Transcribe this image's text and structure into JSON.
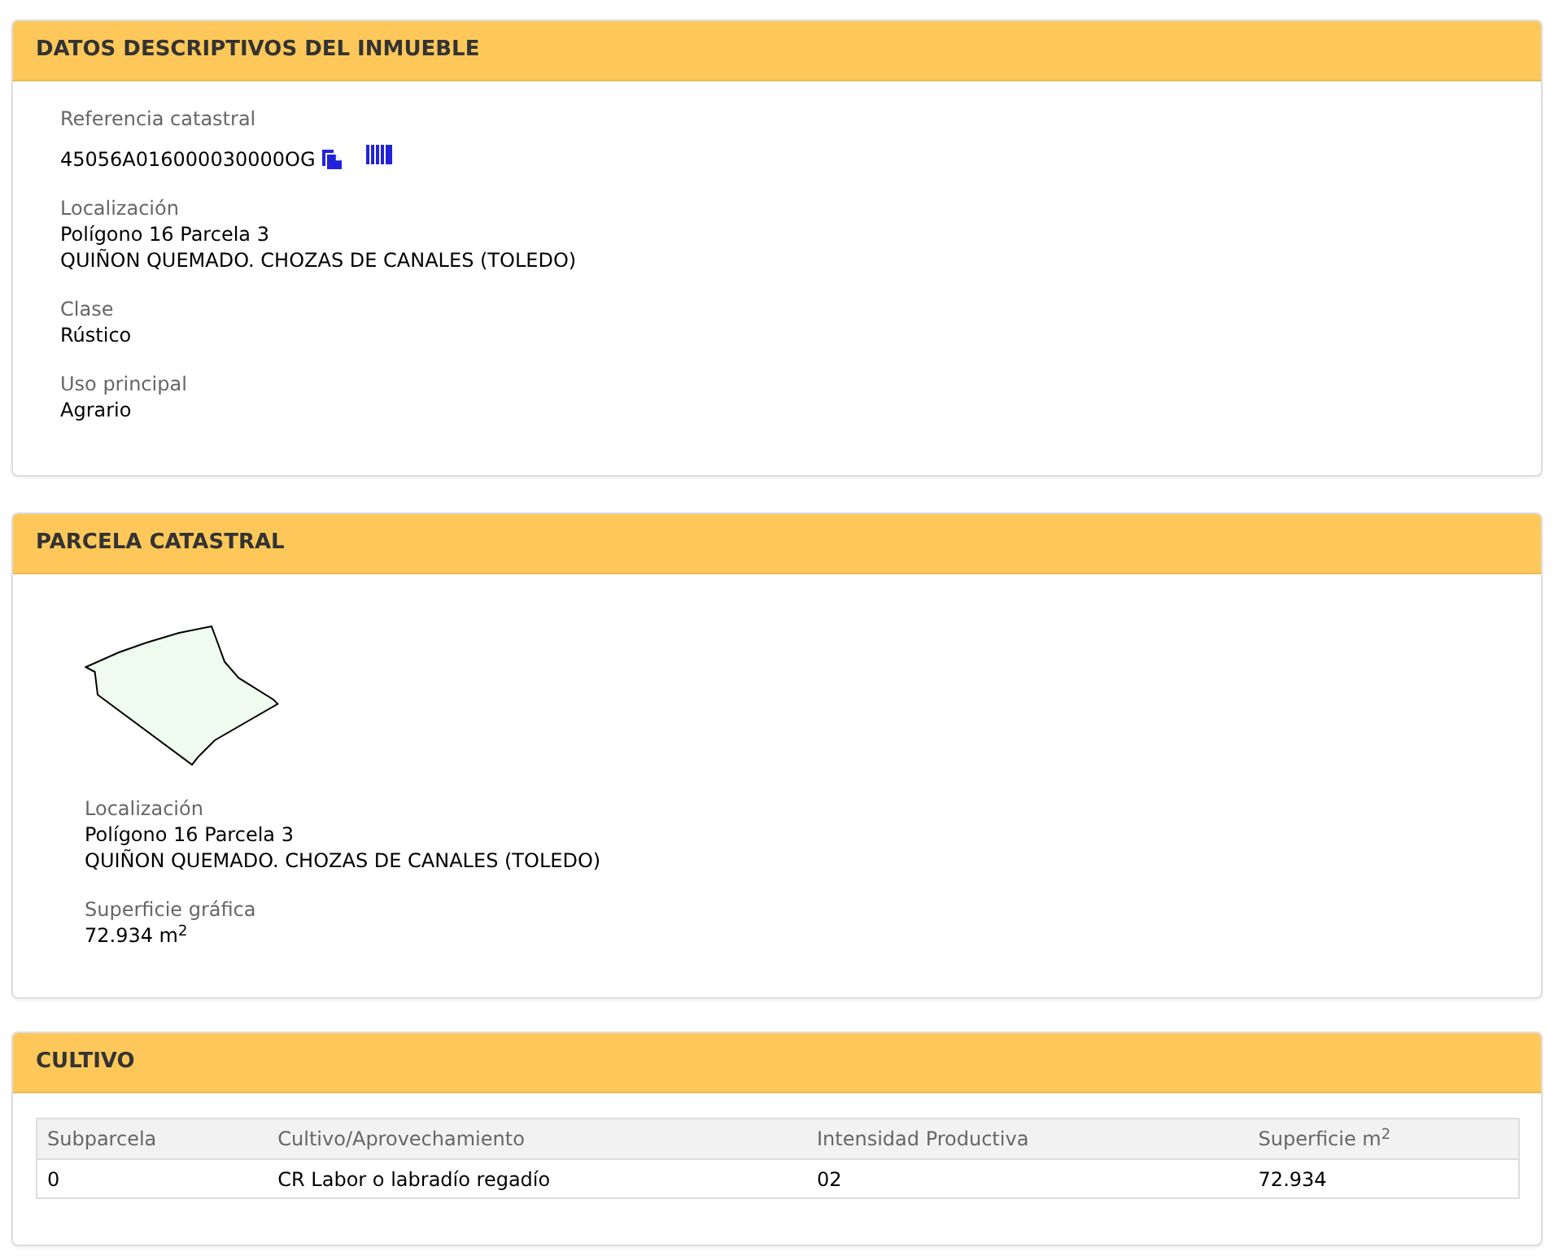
{
  "property_details": {
    "title": "DATOS DESCRIPTIVOS DEL INMUEBLE",
    "fields": [
      {
        "kind": "reference",
        "label": "Referencia catastral",
        "lines": [
          "45056A016000030000OG"
        ]
      },
      {
        "kind": "text",
        "label": "Localización",
        "lines": [
          "Polígono 16 Parcela 3",
          "QUIÑON QUEMADO. CHOZAS DE CANALES (TOLEDO)"
        ]
      },
      {
        "kind": "text",
        "label": "Clase",
        "lines": [
          "Rústico"
        ]
      },
      {
        "kind": "text",
        "label": "Uso principal",
        "lines": [
          "Agrario"
        ]
      }
    ]
  },
  "parcel": {
    "title": "PARCELA CATASTRAL",
    "fields": [
      {
        "kind": "text",
        "label": "Localización",
        "lines": [
          "Polígono 16 Parcela 3",
          "QUIÑON QUEMADO. CHOZAS DE CANALES (TOLEDO)"
        ]
      },
      {
        "kind": "text",
        "label": "Superficie gráfica",
        "lines": [
          "72.934 m$^{2}$"
        ]
      }
    ]
  },
  "crops": {
    "title": "CULTIVO",
    "table": {
      "columns": [
        "Subparcela",
        "Cultivo/Aprovechamiento",
        "Intensidad Productiva",
        "Superficie m$^{2}$"
      ],
      "rows": [
        [
          "0",
          "CR Labor o labradío regadío",
          "02",
          "72.934"
        ]
      ]
    }
  }
}
